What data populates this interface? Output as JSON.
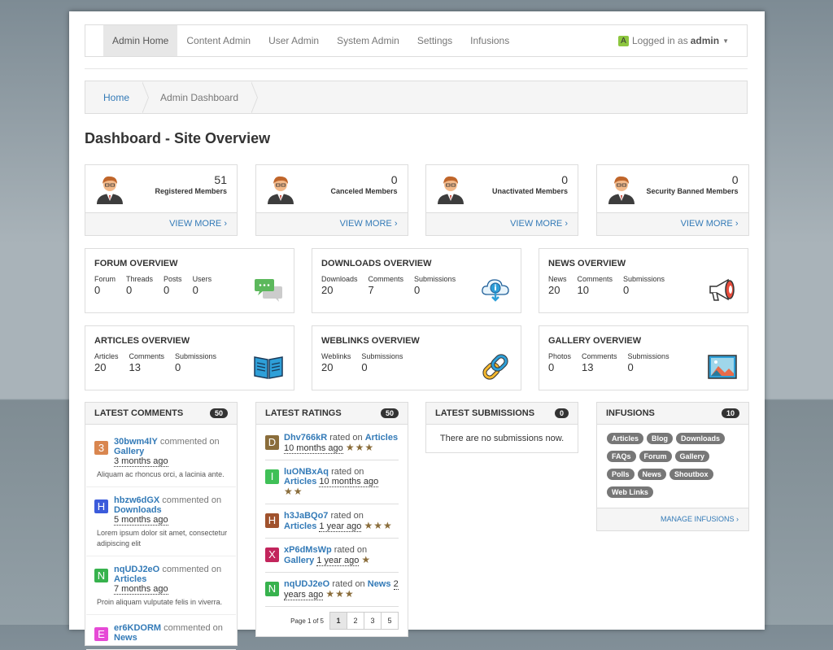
{
  "nav": {
    "items": [
      "Admin Home",
      "Content Admin",
      "User Admin",
      "System Admin",
      "Settings",
      "Infusions"
    ],
    "active": "Admin Home"
  },
  "user": {
    "avatar_letter": "A",
    "prefix": "Logged in as",
    "name": "admin"
  },
  "breadcrumb": {
    "home": "Home",
    "current": "Admin Dashboard"
  },
  "page_title": "Dashboard - Site Overview",
  "member_stats": [
    {
      "count": "51",
      "label": "Registered Members",
      "link": "VIEW MORE"
    },
    {
      "count": "0",
      "label": "Canceled Members",
      "link": "VIEW MORE"
    },
    {
      "count": "0",
      "label": "Unactivated Members",
      "link": "VIEW MORE"
    },
    {
      "count": "0",
      "label": "Security Banned Members",
      "link": "VIEW MORE"
    }
  ],
  "overviews": [
    {
      "title": "FORUM OVERVIEW",
      "icon": "chat-bubbles-icon",
      "cols": [
        {
          "k": "Forum",
          "v": "0"
        },
        {
          "k": "Threads",
          "v": "0"
        },
        {
          "k": "Posts",
          "v": "0"
        },
        {
          "k": "Users",
          "v": "0"
        }
      ]
    },
    {
      "title": "DOWNLOADS OVERVIEW",
      "icon": "cloud-download-icon",
      "cols": [
        {
          "k": "Downloads",
          "v": "20"
        },
        {
          "k": "Comments",
          "v": "7"
        },
        {
          "k": "Submissions",
          "v": "0"
        }
      ]
    },
    {
      "title": "NEWS OVERVIEW",
      "icon": "megaphone-icon",
      "cols": [
        {
          "k": "News",
          "v": "20"
        },
        {
          "k": "Comments",
          "v": "10"
        },
        {
          "k": "Submissions",
          "v": "0"
        }
      ]
    },
    {
      "title": "ARTICLES OVERVIEW",
      "icon": "book-icon",
      "cols": [
        {
          "k": "Articles",
          "v": "20"
        },
        {
          "k": "Comments",
          "v": "13"
        },
        {
          "k": "Submissions",
          "v": "0"
        }
      ]
    },
    {
      "title": "WEBLINKS OVERVIEW",
      "icon": "chain-link-icon",
      "cols": [
        {
          "k": "Weblinks",
          "v": "20"
        },
        {
          "k": "Submissions",
          "v": "0"
        }
      ]
    },
    {
      "title": "GALLERY OVERVIEW",
      "icon": "picture-icon",
      "cols": [
        {
          "k": "Photos",
          "v": "0"
        },
        {
          "k": "Comments",
          "v": "13"
        },
        {
          "k": "Submissions",
          "v": "0"
        }
      ]
    }
  ],
  "latest_comments": {
    "title": "LATEST COMMENTS",
    "badge": "50",
    "items": [
      {
        "letter": "3",
        "color": "#d9864f",
        "user": "30bwm4lY",
        "verb": "commented on",
        "target": "Gallery",
        "time": "3 months ago",
        "text": "Aliquam ac rhoncus orci, a lacinia ante."
      },
      {
        "letter": "H",
        "color": "#3b5bdb",
        "user": "hbzw6dGX",
        "verb": "commented on",
        "target": "Downloads",
        "time": "5 months ago",
        "text": "Lorem ipsum dolor sit amet, consectetur adipiscing elit"
      },
      {
        "letter": "N",
        "color": "#37b24d",
        "user": "nqUDJ2eO",
        "verb": "commented on",
        "target": "Articles",
        "time": "7 months ago",
        "text": "Proin aliquam vulputate felis in viverra."
      },
      {
        "letter": "E",
        "color": "#e64ad6",
        "user": "er6KDORM",
        "verb": "commented on",
        "target": "News",
        "time": "",
        "text": ""
      }
    ]
  },
  "latest_ratings": {
    "title": "LATEST RATINGS",
    "badge": "50",
    "items": [
      {
        "letter": "D",
        "color": "#8a6d3b",
        "user": "Dhv766kR",
        "verb": "rated on",
        "target": "Articles",
        "time": "10 months ago",
        "stars": "★★★"
      },
      {
        "letter": "I",
        "color": "#40c057",
        "user": "luONBxAq",
        "verb": "rated on",
        "target": "Articles",
        "time": "10 months ago",
        "stars": "★★"
      },
      {
        "letter": "H",
        "color": "#a0522d",
        "user": "h3JaBQo7",
        "verb": "rated on",
        "target": "Articles",
        "time": "1 year ago",
        "stars": "★★★"
      },
      {
        "letter": "X",
        "color": "#c2255c",
        "user": "xP6dMsWp",
        "verb": "rated on",
        "target": "Gallery",
        "time": "1 year ago",
        "stars": "★"
      },
      {
        "letter": "N",
        "color": "#37b24d",
        "user": "nqUDJ2eO",
        "verb": "rated on",
        "target": "News",
        "time": "2 years ago",
        "stars": "★★★"
      }
    ],
    "pager": {
      "label": "Page 1 of 5",
      "pages": [
        "1",
        "2",
        "3",
        "5"
      ],
      "active": "1"
    }
  },
  "latest_submissions": {
    "title": "LATEST SUBMISSIONS",
    "badge": "0",
    "empty": "There are no submissions now."
  },
  "infusions": {
    "title": "INFUSIONS",
    "badge": "10",
    "items": [
      "Articles",
      "Blog",
      "Downloads",
      "FAQs",
      "Forum",
      "Gallery",
      "Polls",
      "News",
      "Shoutbox",
      "Web Links"
    ],
    "link": "MANAGE INFUSIONS"
  }
}
